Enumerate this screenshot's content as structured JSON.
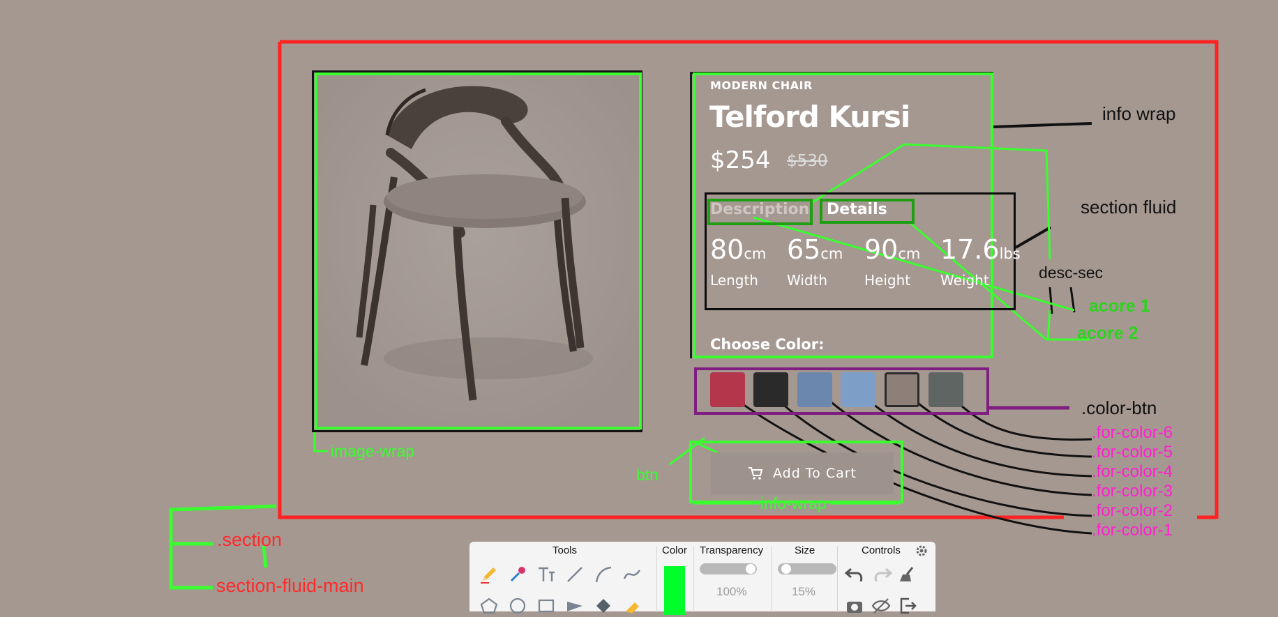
{
  "product": {
    "category": "MODERN CHAIR",
    "name": "Telford Kursi",
    "price": "$254",
    "old_price": "$530",
    "tabs": [
      "Description",
      "Details"
    ],
    "specs": [
      {
        "value": "80",
        "unit": "cm",
        "label": "Length"
      },
      {
        "value": "65",
        "unit": "cm",
        "label": "Width"
      },
      {
        "value": "90",
        "unit": "cm",
        "label": "Height"
      },
      {
        "value": "17.6",
        "unit": "lbs",
        "label": "Weight"
      }
    ],
    "choose_color_label": "Choose Color:",
    "colors": [
      "#b3364b",
      "#2a2a2a",
      "#6b87ad",
      "#7c9ec7",
      "#8e8079",
      "#5f6563"
    ],
    "add_to_cart_label": "Add To Cart"
  },
  "annotations": {
    "info_wrap_top": "info wrap",
    "section_fluid": "section fluid",
    "desc_sec": "desc-sec",
    "acore_1": "acore 1",
    "acore_2": "acore 2",
    "color_btn": ".color-btn",
    "for_colors": [
      ".for-color-6",
      ".for-color-5",
      ".for-color-4",
      ".for-color-3",
      ".for-color-2",
      ".for-color-1"
    ],
    "image_wrap": "image-wrap",
    "btn": "btn",
    "info_wrap_bottom": "info-wrap",
    "section": ".section",
    "section_fluid_main": "section-fluid-main"
  },
  "tools_panel": {
    "headers": {
      "tools": "Tools",
      "color": "Color",
      "transparency": "Transparency",
      "size": "Size",
      "controls": "Controls"
    },
    "current_color": "#00ff2a",
    "transparency": "100%",
    "size": "15%"
  }
}
